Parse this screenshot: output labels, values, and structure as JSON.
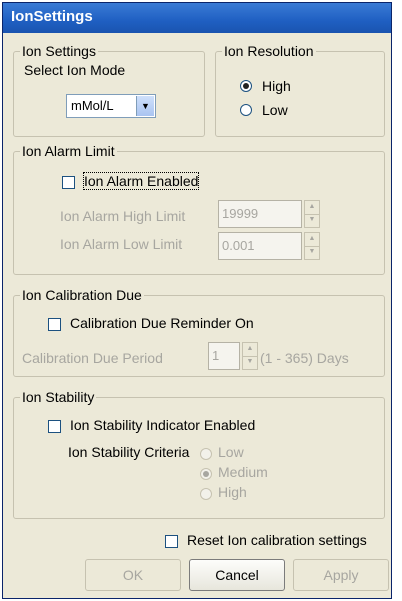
{
  "window": {
    "title": "IonSettings"
  },
  "ion_settings": {
    "legend": "Ion Settings",
    "select_label": "Select Ion Mode",
    "mode_value": "mMol/L"
  },
  "ion_resolution": {
    "legend": "Ion Resolution",
    "options": [
      "High",
      "Low"
    ],
    "selected": "High"
  },
  "alarm": {
    "legend": "Ion Alarm Limit",
    "enabled_label": "Ion Alarm Enabled",
    "enabled_checked": false,
    "high_label": "Ion Alarm High Limit",
    "high_value": "19999",
    "low_label": "Ion Alarm Low Limit",
    "low_value": "0.001"
  },
  "calibration": {
    "legend": "Ion Calibration Due",
    "reminder_label": "Calibration Due Reminder On",
    "reminder_checked": false,
    "period_label": "Calibration Due Period",
    "period_value": "1",
    "period_suffix": "(1 - 365) Days"
  },
  "stability": {
    "legend": "Ion Stability",
    "indicator_label": "Ion Stability Indicator Enabled",
    "indicator_checked": false,
    "criteria_label": "Ion Stability Criteria",
    "criteria_options": [
      "Low",
      "Medium",
      "High"
    ],
    "criteria_selected": "Medium"
  },
  "reset": {
    "label": "Reset Ion calibration settings",
    "checked": false
  },
  "buttons": {
    "ok": "OK",
    "cancel": "Cancel",
    "apply": "Apply"
  }
}
